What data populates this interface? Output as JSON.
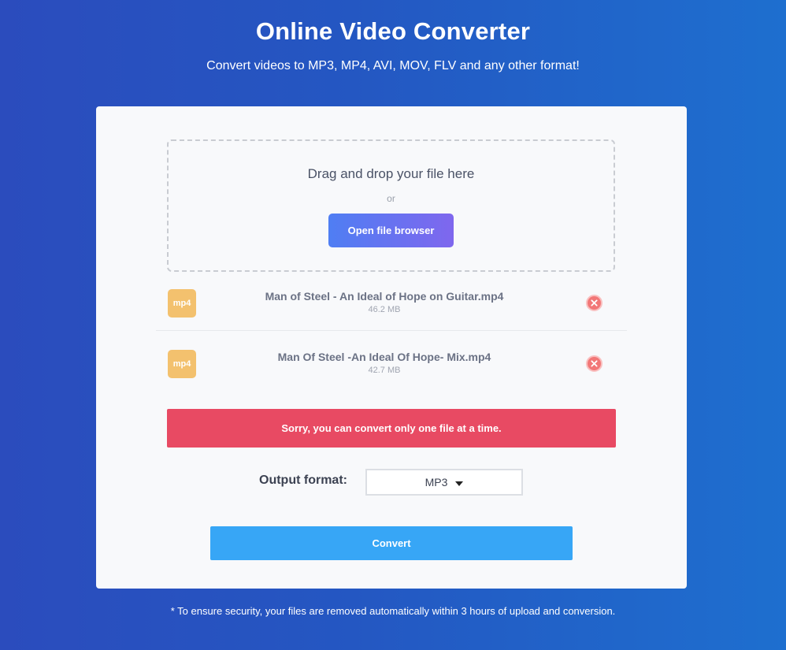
{
  "header": {
    "title": "Online Video Converter",
    "subtitle": "Convert videos to MP3, MP4, AVI, MOV, FLV and any other format!"
  },
  "dropzone": {
    "prompt": "Drag and drop your file here",
    "or": "or",
    "open_button": "Open file browser"
  },
  "files": [
    {
      "badge": "mp4",
      "name": "Man of Steel - An Ideal of Hope on Guitar.mp4",
      "size": "46.2 MB",
      "remove_icon": "close-icon"
    },
    {
      "badge": "mp4",
      "name": "Man Of Steel -An Ideal Of Hope- Mix.mp4",
      "size": "42.7 MB",
      "remove_icon": "close-icon"
    }
  ],
  "error": {
    "message": "Sorry, you can convert only one file at a time."
  },
  "output": {
    "label": "Output format:",
    "selected": "MP3"
  },
  "convert_button": "Convert",
  "footnote": "* To ensure security, your files are removed automatically within 3 hours of upload and conversion.",
  "colors": {
    "open_button_start": "#4f7ef3",
    "open_button_end": "#7f67ee",
    "file_badge": "#f3c16e",
    "remove_button": "#f27777",
    "error_banner": "#e84a63",
    "convert_button": "#37a6f6"
  }
}
